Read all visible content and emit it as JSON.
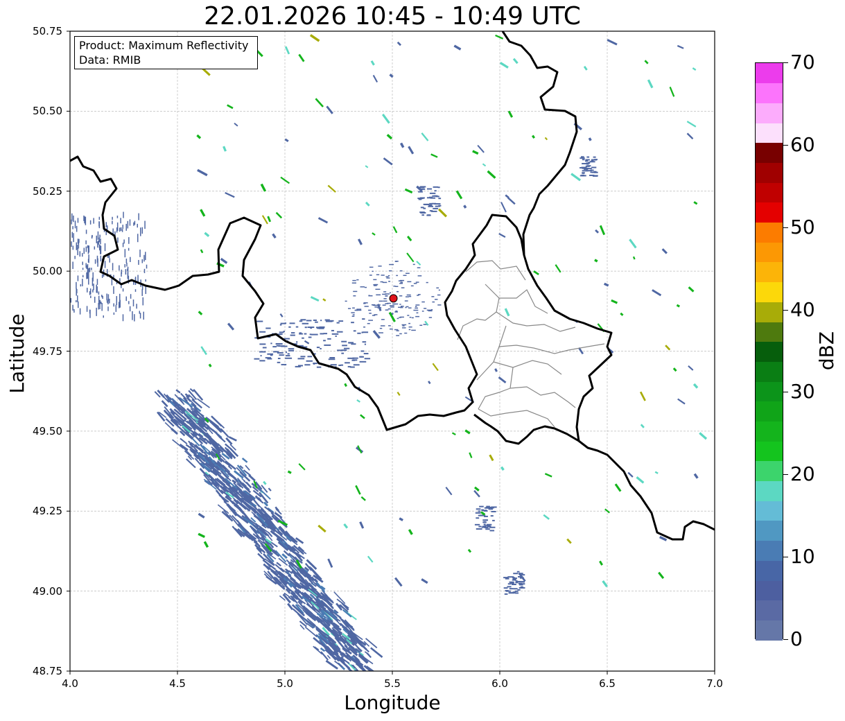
{
  "title": "22.01.2026 10:45 - 10:49 UTC",
  "info": {
    "product_line": "Product: Maximum Reflectivity",
    "data_line": "Data: RMIB"
  },
  "axes": {
    "xlabel": "Longitude",
    "ylabel": "Latitude",
    "xlim": [
      4.0,
      7.0
    ],
    "ylim": [
      48.75,
      50.75
    ],
    "x_ticks": [
      "4.0",
      "4.5",
      "5.0",
      "5.5",
      "6.0",
      "6.5",
      "7.0"
    ],
    "y_ticks": [
      "50.75",
      "50.50",
      "50.25",
      "50.00",
      "49.75",
      "49.50",
      "49.25",
      "49.00",
      "48.75"
    ],
    "grid": true
  },
  "radar_site": {
    "lon": 5.505,
    "lat": 49.915,
    "color": "#e0141c"
  },
  "colorbar": {
    "label": "dBZ",
    "ticks": [
      "0",
      "10",
      "20",
      "30",
      "40",
      "50",
      "60",
      "70"
    ],
    "range": [
      0,
      70
    ],
    "colors": [
      "#6577a8",
      "#5a6aa4",
      "#4d5fa0",
      "#4866a6",
      "#4a7cb4",
      "#5098c2",
      "#64bcd6",
      "#5cd8c2",
      "#3cd46c",
      "#14c41e",
      "#14b41c",
      "#10a418",
      "#0c941a",
      "#0a7e14",
      "#065e0c",
      "#4e7a0e",
      "#a8ac08",
      "#fcd80a",
      "#fcb408",
      "#fc9804",
      "#fc7c00",
      "#e40000",
      "#c00000",
      "#a00000",
      "#780000",
      "#fce0fc",
      "#fcacfc",
      "#fc74fc",
      "#ec3cec"
    ]
  },
  "echo_palette": {
    "weak": "#4f67a3",
    "light": "#4a7cb4",
    "cyan": "#5cd8c2",
    "green": "#14b41c",
    "yellowgreen": "#a8ac08"
  },
  "chart_data": {
    "type": "heatmap",
    "title": "22.01.2026 10:45 - 10:49 UTC",
    "xlabel": "Longitude",
    "ylabel": "Latitude",
    "xlim": [
      4.0,
      7.0
    ],
    "ylim": [
      48.75,
      50.75
    ],
    "colorbar_label": "dBZ",
    "colorbar_range": [
      0,
      70
    ],
    "annotation": [
      "Product: Maximum Reflectivity",
      "Data: RMIB"
    ]
  }
}
